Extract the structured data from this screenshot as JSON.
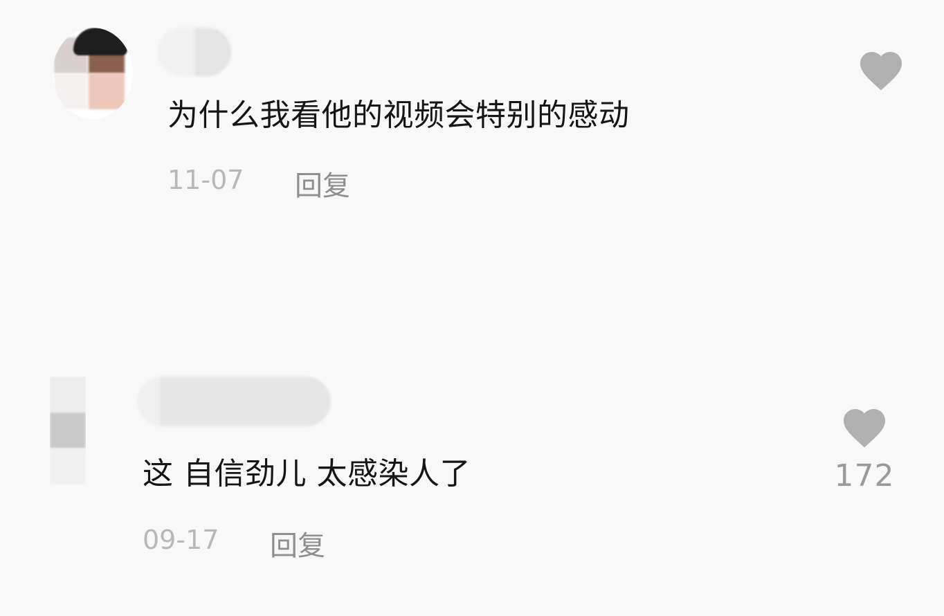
{
  "comments": [
    {
      "text": "为什么我看他的视频会特别的感动",
      "date": "11-07",
      "reply_label": "回复",
      "like_icon": "heart-icon",
      "like_count": ""
    },
    {
      "text": "这 自信劲儿 太感染人了",
      "date": "09-17",
      "reply_label": "回复",
      "like_icon": "heart-icon",
      "like_count": "172"
    }
  ],
  "colors": {
    "background": "#f8f8f8",
    "comment_text": "#151515",
    "date_text": "#b8b8b8",
    "reply_text": "#8e8e8e",
    "heart": "#b0b0b0",
    "like_count": "#9a9a9a"
  }
}
